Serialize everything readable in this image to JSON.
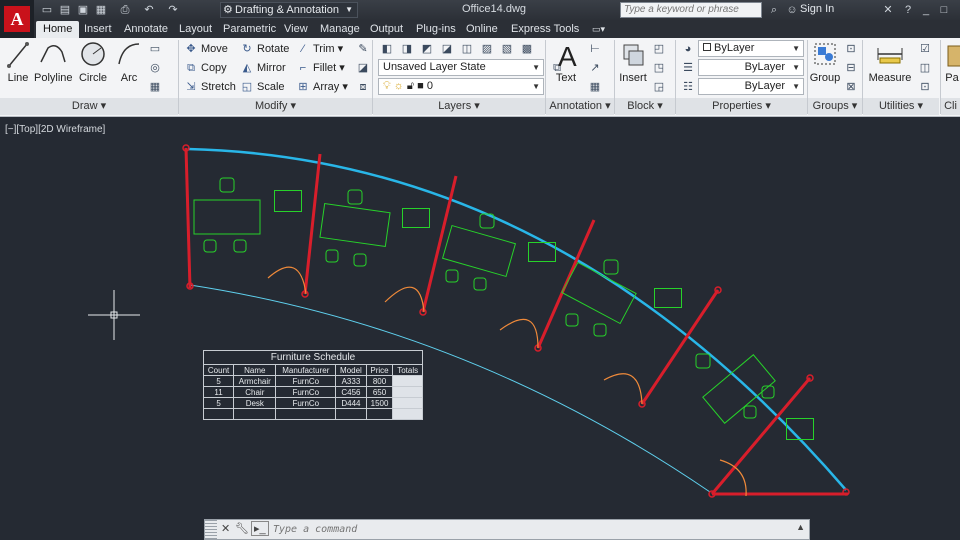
{
  "titlebar": {
    "workspace": "Drafting & Annotation",
    "file_title": "Office14.dwg",
    "search_placeholder": "Type a keyword or phrase",
    "signin": "Sign In"
  },
  "tabs": [
    "Home",
    "Insert",
    "Annotate",
    "Layout",
    "Parametric",
    "View",
    "Manage",
    "Output",
    "Plug-ins",
    "Online",
    "Express Tools"
  ],
  "ribbon": {
    "draw": {
      "title": "Draw",
      "line": "Line",
      "polyline": "Polyline",
      "circle": "Circle",
      "arc": "Arc"
    },
    "modify": {
      "title": "Modify",
      "move": "Move",
      "rotate": "Rotate",
      "trim": "Trim",
      "copy": "Copy",
      "mirror": "Mirror",
      "fillet": "Fillet",
      "stretch": "Stretch",
      "scale": "Scale",
      "array": "Array"
    },
    "layers": {
      "title": "Layers",
      "layer_state": "Unsaved Layer State",
      "current_layer": "0"
    },
    "annotation": {
      "title": "Annotation",
      "text": "Text"
    },
    "block": {
      "title": "Block",
      "insert": "Insert"
    },
    "properties": {
      "title": "Properties",
      "color": "ByLayer",
      "linetype": "ByLayer",
      "lineweight": "ByLayer"
    },
    "groups": {
      "title": "Groups",
      "group": "Group"
    },
    "utilities": {
      "title": "Utilities",
      "measure": "Measure"
    },
    "clipboard": {
      "paste": "Pa",
      "title": "Cli"
    }
  },
  "viewport_label": "[−][Top][2D Wireframe]",
  "schedule": {
    "title": "Furniture Schedule",
    "headers": [
      "Count",
      "Name",
      "Manufacturer",
      "Model",
      "Price",
      "Totals"
    ],
    "rows": [
      [
        "5",
        "Armchair",
        "FurnCo",
        "A333",
        "800",
        ""
      ],
      [
        "11",
        "Chair",
        "FurnCo",
        "C456",
        "650",
        ""
      ],
      [
        "5",
        "Desk",
        "FurnCo",
        "D444",
        "1500",
        ""
      ]
    ]
  },
  "command": {
    "placeholder": "Type a command"
  },
  "colors": {
    "wall_red": "#d81e2b",
    "arc_blue": "#29b6e8",
    "furniture_green": "#27d22a",
    "door_orange": "#f08a3a"
  }
}
